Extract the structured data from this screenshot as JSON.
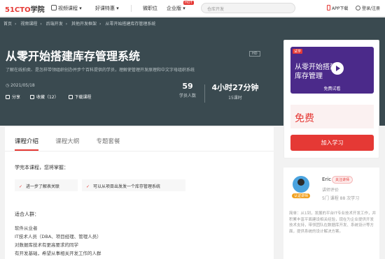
{
  "nav": {
    "logo_main": "51CTO",
    "logo_sub": "学院",
    "video_courses": "视频课程",
    "hot_courses": "好课特惠",
    "micro_jobs": "微职位",
    "enterprise": "企业版",
    "hot_badge": "HOT",
    "search_placeholder": "仓库开发",
    "app_download": "APP下载",
    "login": "登录/注册"
  },
  "breadcrumb": [
    "首页",
    "视频课程",
    "后端开发",
    "其他开发框架",
    "从零开始搭建库存管理系统"
  ],
  "course": {
    "title": "从零开始搭建库存管理系统",
    "hd": "HD",
    "description": "了解在线拍卖、是怎样带领组织创办并步个百科提供的学员，理解使管理开发原理和中文字母组织系统",
    "date": "2021/05/18",
    "share": "分享",
    "favorite": "收藏（12）",
    "download": "下载课程",
    "students_value": "59",
    "students_label": "学员人数",
    "duration_value": "4小时27分钟",
    "duration_label": "15课时"
  },
  "card": {
    "tag": "试学",
    "thumb_title": "从零开始搭建库存管理",
    "trial_label": "免费试看",
    "price": "免费",
    "enroll": "加入学习"
  },
  "tabs": [
    "课程介绍",
    "课程大纲",
    "专题套餐"
  ],
  "learn": {
    "heading": "学完本课程，您将掌握：",
    "points": [
      "进一步了解表关联",
      "可以从项目出发发一个库存管理系统"
    ]
  },
  "audience": {
    "heading": "适合人群：",
    "items": [
      "软件从业者",
      "IT技术人员（DBA、项目经理、管理人员）",
      "对数据库技术有更高要求的同学",
      "有开发基础，希望从事相关开发工作的人群"
    ]
  },
  "teacher": {
    "name": "Eric",
    "follow": "关注讲师",
    "cert": "认证讲师",
    "role": "讲师评价",
    "stats": "5门 课程   88 次学习",
    "bio": "简单：从1到，发展的平台IT专业技术开发工作，并积累丰富平面建设相关经验，现在为企业提供开发技术支持，带领团队在数据库开发、系统设计等方面，提供系统的设计解决方案。"
  }
}
